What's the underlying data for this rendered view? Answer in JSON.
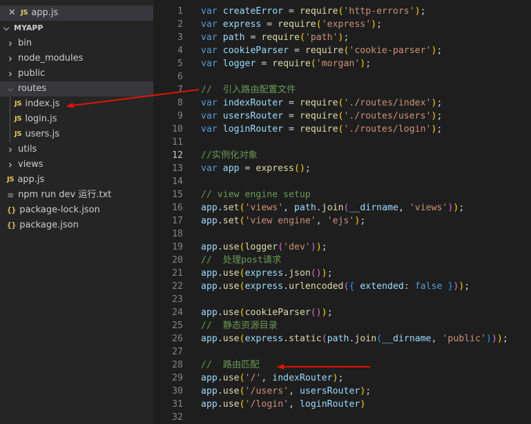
{
  "open_editors": {
    "file": "app.js",
    "close_glyph": "✕",
    "file_type": "JS"
  },
  "explorer": {
    "project": "MYAPP",
    "items": [
      {
        "name": "bin",
        "kind": "folder",
        "expanded": false
      },
      {
        "name": "node_modules",
        "kind": "folder",
        "expanded": false
      },
      {
        "name": "public",
        "kind": "folder",
        "expanded": false
      },
      {
        "name": "routes",
        "kind": "folder",
        "expanded": true
      },
      {
        "name": "index.js",
        "kind": "child-js"
      },
      {
        "name": "login.js",
        "kind": "child-js"
      },
      {
        "name": "users.js",
        "kind": "child-js"
      },
      {
        "name": "utils",
        "kind": "folder",
        "expanded": false
      },
      {
        "name": "views",
        "kind": "folder",
        "expanded": false
      },
      {
        "name": "app.js",
        "kind": "js"
      },
      {
        "name": "npm run  dev  运行.txt",
        "kind": "txt"
      },
      {
        "name": "package-lock.json",
        "kind": "json"
      },
      {
        "name": "package.json",
        "kind": "json"
      }
    ]
  },
  "editor": {
    "current_line": 12,
    "lines": [
      {
        "n": 1,
        "tokens": [
          [
            "kw",
            "var "
          ],
          [
            "var",
            "createError"
          ],
          [
            "pl",
            " = "
          ],
          [
            "fn",
            "require"
          ],
          [
            "br1",
            "("
          ],
          [
            "str",
            "'http-errors'"
          ],
          [
            "br1",
            ")"
          ],
          [
            "pl",
            ";"
          ]
        ]
      },
      {
        "n": 2,
        "tokens": [
          [
            "kw",
            "var "
          ],
          [
            "var",
            "express"
          ],
          [
            "pl",
            " = "
          ],
          [
            "fn",
            "require"
          ],
          [
            "br1",
            "("
          ],
          [
            "str",
            "'express'"
          ],
          [
            "br1",
            ")"
          ],
          [
            "pl",
            ";"
          ]
        ]
      },
      {
        "n": 3,
        "tokens": [
          [
            "kw",
            "var "
          ],
          [
            "var",
            "path"
          ],
          [
            "pl",
            " = "
          ],
          [
            "fn",
            "require"
          ],
          [
            "br1",
            "("
          ],
          [
            "str",
            "'path'"
          ],
          [
            "br1",
            ")"
          ],
          [
            "pl",
            ";"
          ]
        ]
      },
      {
        "n": 4,
        "tokens": [
          [
            "kw",
            "var "
          ],
          [
            "var",
            "cookieParser"
          ],
          [
            "pl",
            " = "
          ],
          [
            "fn",
            "require"
          ],
          [
            "br1",
            "("
          ],
          [
            "str",
            "'cookie-parser'"
          ],
          [
            "br1",
            ")"
          ],
          [
            "pl",
            ";"
          ]
        ]
      },
      {
        "n": 5,
        "tokens": [
          [
            "kw",
            "var "
          ],
          [
            "var",
            "logger"
          ],
          [
            "pl",
            " = "
          ],
          [
            "fn",
            "require"
          ],
          [
            "br1",
            "("
          ],
          [
            "str",
            "'morgan'"
          ],
          [
            "br1",
            ")"
          ],
          [
            "pl",
            ";"
          ]
        ]
      },
      {
        "n": 6,
        "tokens": []
      },
      {
        "n": 7,
        "tokens": [
          [
            "cmt",
            "//  引入路由配置文件"
          ]
        ]
      },
      {
        "n": 8,
        "tokens": [
          [
            "kw",
            "var "
          ],
          [
            "var",
            "indexRouter"
          ],
          [
            "pl",
            " = "
          ],
          [
            "fn",
            "require"
          ],
          [
            "br1",
            "("
          ],
          [
            "str",
            "'./routes/index'"
          ],
          [
            "br1",
            ")"
          ],
          [
            "pl",
            ";"
          ]
        ]
      },
      {
        "n": 9,
        "tokens": [
          [
            "kw",
            "var "
          ],
          [
            "var",
            "usersRouter"
          ],
          [
            "pl",
            " = "
          ],
          [
            "fn",
            "require"
          ],
          [
            "br1",
            "("
          ],
          [
            "str",
            "'./routes/users'"
          ],
          [
            "br1",
            ")"
          ],
          [
            "pl",
            ";"
          ]
        ]
      },
      {
        "n": 10,
        "tokens": [
          [
            "kw",
            "var "
          ],
          [
            "var",
            "loginRouter"
          ],
          [
            "pl",
            " = "
          ],
          [
            "fn",
            "require"
          ],
          [
            "br1",
            "("
          ],
          [
            "str",
            "'./routes/login'"
          ],
          [
            "br1",
            ")"
          ],
          [
            "pl",
            ";"
          ]
        ]
      },
      {
        "n": 11,
        "tokens": []
      },
      {
        "n": 12,
        "tokens": [
          [
            "cmt",
            "//实例化对象"
          ]
        ]
      },
      {
        "n": 13,
        "tokens": [
          [
            "kw",
            "var "
          ],
          [
            "var",
            "app"
          ],
          [
            "pl",
            " = "
          ],
          [
            "fn",
            "express"
          ],
          [
            "br1",
            "()"
          ],
          [
            "pl",
            ";"
          ]
        ]
      },
      {
        "n": 14,
        "tokens": []
      },
      {
        "n": 15,
        "tokens": [
          [
            "cmt",
            "// view engine setup"
          ]
        ]
      },
      {
        "n": 16,
        "tokens": [
          [
            "var",
            "app"
          ],
          [
            "pl",
            "."
          ],
          [
            "fn",
            "set"
          ],
          [
            "br1",
            "("
          ],
          [
            "str",
            "'views'"
          ],
          [
            "pl",
            ", "
          ],
          [
            "var",
            "path"
          ],
          [
            "pl",
            "."
          ],
          [
            "fn",
            "join"
          ],
          [
            "br2",
            "("
          ],
          [
            "var",
            "__dirname"
          ],
          [
            "pl",
            ", "
          ],
          [
            "str",
            "'views'"
          ],
          [
            "br2",
            ")"
          ],
          [
            "br1",
            ")"
          ],
          [
            "pl",
            ";"
          ]
        ]
      },
      {
        "n": 17,
        "tokens": [
          [
            "var",
            "app"
          ],
          [
            "pl",
            "."
          ],
          [
            "fn",
            "set"
          ],
          [
            "br1",
            "("
          ],
          [
            "str",
            "'view engine'"
          ],
          [
            "pl",
            ", "
          ],
          [
            "str",
            "'ejs'"
          ],
          [
            "br1",
            ")"
          ],
          [
            "pl",
            ";"
          ]
        ]
      },
      {
        "n": 18,
        "tokens": []
      },
      {
        "n": 19,
        "tokens": [
          [
            "var",
            "app"
          ],
          [
            "pl",
            "."
          ],
          [
            "fn",
            "use"
          ],
          [
            "br1",
            "("
          ],
          [
            "fn",
            "logger"
          ],
          [
            "br2",
            "("
          ],
          [
            "str",
            "'dev'"
          ],
          [
            "br2",
            ")"
          ],
          [
            "br1",
            ")"
          ],
          [
            "pl",
            ";"
          ]
        ]
      },
      {
        "n": 20,
        "tokens": [
          [
            "cmt",
            "//  处理post请求"
          ]
        ]
      },
      {
        "n": 21,
        "tokens": [
          [
            "var",
            "app"
          ],
          [
            "pl",
            "."
          ],
          [
            "fn",
            "use"
          ],
          [
            "br1",
            "("
          ],
          [
            "var",
            "express"
          ],
          [
            "pl",
            "."
          ],
          [
            "fn",
            "json"
          ],
          [
            "br2",
            "()"
          ],
          [
            "br1",
            ")"
          ],
          [
            "pl",
            ";"
          ]
        ]
      },
      {
        "n": 22,
        "tokens": [
          [
            "var",
            "app"
          ],
          [
            "pl",
            "."
          ],
          [
            "fn",
            "use"
          ],
          [
            "br1",
            "("
          ],
          [
            "var",
            "express"
          ],
          [
            "pl",
            "."
          ],
          [
            "fn",
            "urlencoded"
          ],
          [
            "br2",
            "("
          ],
          [
            "br3",
            "{ "
          ],
          [
            "var",
            "extended"
          ],
          [
            "pl",
            ": "
          ],
          [
            "flg",
            "false"
          ],
          [
            "br3",
            " }"
          ],
          [
            "br2",
            ")"
          ],
          [
            "br1",
            ")"
          ],
          [
            "pl",
            ";"
          ]
        ]
      },
      {
        "n": 23,
        "tokens": []
      },
      {
        "n": 24,
        "tokens": [
          [
            "var",
            "app"
          ],
          [
            "pl",
            "."
          ],
          [
            "fn",
            "use"
          ],
          [
            "br1",
            "("
          ],
          [
            "fn",
            "cookieParser"
          ],
          [
            "br2",
            "()"
          ],
          [
            "br1",
            ")"
          ],
          [
            "pl",
            ";"
          ]
        ]
      },
      {
        "n": 25,
        "tokens": [
          [
            "cmt",
            "//  静态资源目录"
          ]
        ]
      },
      {
        "n": 26,
        "tokens": [
          [
            "var",
            "app"
          ],
          [
            "pl",
            "."
          ],
          [
            "fn",
            "use"
          ],
          [
            "br1",
            "("
          ],
          [
            "var",
            "express"
          ],
          [
            "pl",
            "."
          ],
          [
            "fn",
            "static"
          ],
          [
            "br2",
            "("
          ],
          [
            "var",
            "path"
          ],
          [
            "pl",
            "."
          ],
          [
            "fn",
            "join"
          ],
          [
            "br3",
            "("
          ],
          [
            "var",
            "__dirname"
          ],
          [
            "pl",
            ", "
          ],
          [
            "str",
            "'public'"
          ],
          [
            "br3",
            ")"
          ],
          [
            "br2",
            ")"
          ],
          [
            "br1",
            ")"
          ],
          [
            "pl",
            ";"
          ]
        ]
      },
      {
        "n": 27,
        "tokens": []
      },
      {
        "n": 28,
        "tokens": [
          [
            "cmt",
            "//  路由匹配"
          ]
        ]
      },
      {
        "n": 29,
        "tokens": [
          [
            "var",
            "app"
          ],
          [
            "pl",
            "."
          ],
          [
            "fn",
            "use"
          ],
          [
            "br1",
            "("
          ],
          [
            "str",
            "'/'"
          ],
          [
            "pl",
            ", "
          ],
          [
            "var",
            "indexRouter"
          ],
          [
            "br1",
            ")"
          ],
          [
            "pl",
            ";"
          ]
        ]
      },
      {
        "n": 30,
        "tokens": [
          [
            "var",
            "app"
          ],
          [
            "pl",
            "."
          ],
          [
            "fn",
            "use"
          ],
          [
            "br1",
            "("
          ],
          [
            "str",
            "'/users'"
          ],
          [
            "pl",
            ", "
          ],
          [
            "var",
            "usersRouter"
          ],
          [
            "br1",
            ")"
          ],
          [
            "pl",
            ";"
          ]
        ]
      },
      {
        "n": 31,
        "tokens": [
          [
            "var",
            "app"
          ],
          [
            "pl",
            "."
          ],
          [
            "fn",
            "use"
          ],
          [
            "br1",
            "("
          ],
          [
            "str",
            "'/login'"
          ],
          [
            "pl",
            ", "
          ],
          [
            "var",
            "loginRouter"
          ],
          [
            "br1",
            ")"
          ]
        ]
      },
      {
        "n": 32,
        "tokens": []
      }
    ]
  },
  "annotations": {
    "arrow_color": "#e51400"
  }
}
